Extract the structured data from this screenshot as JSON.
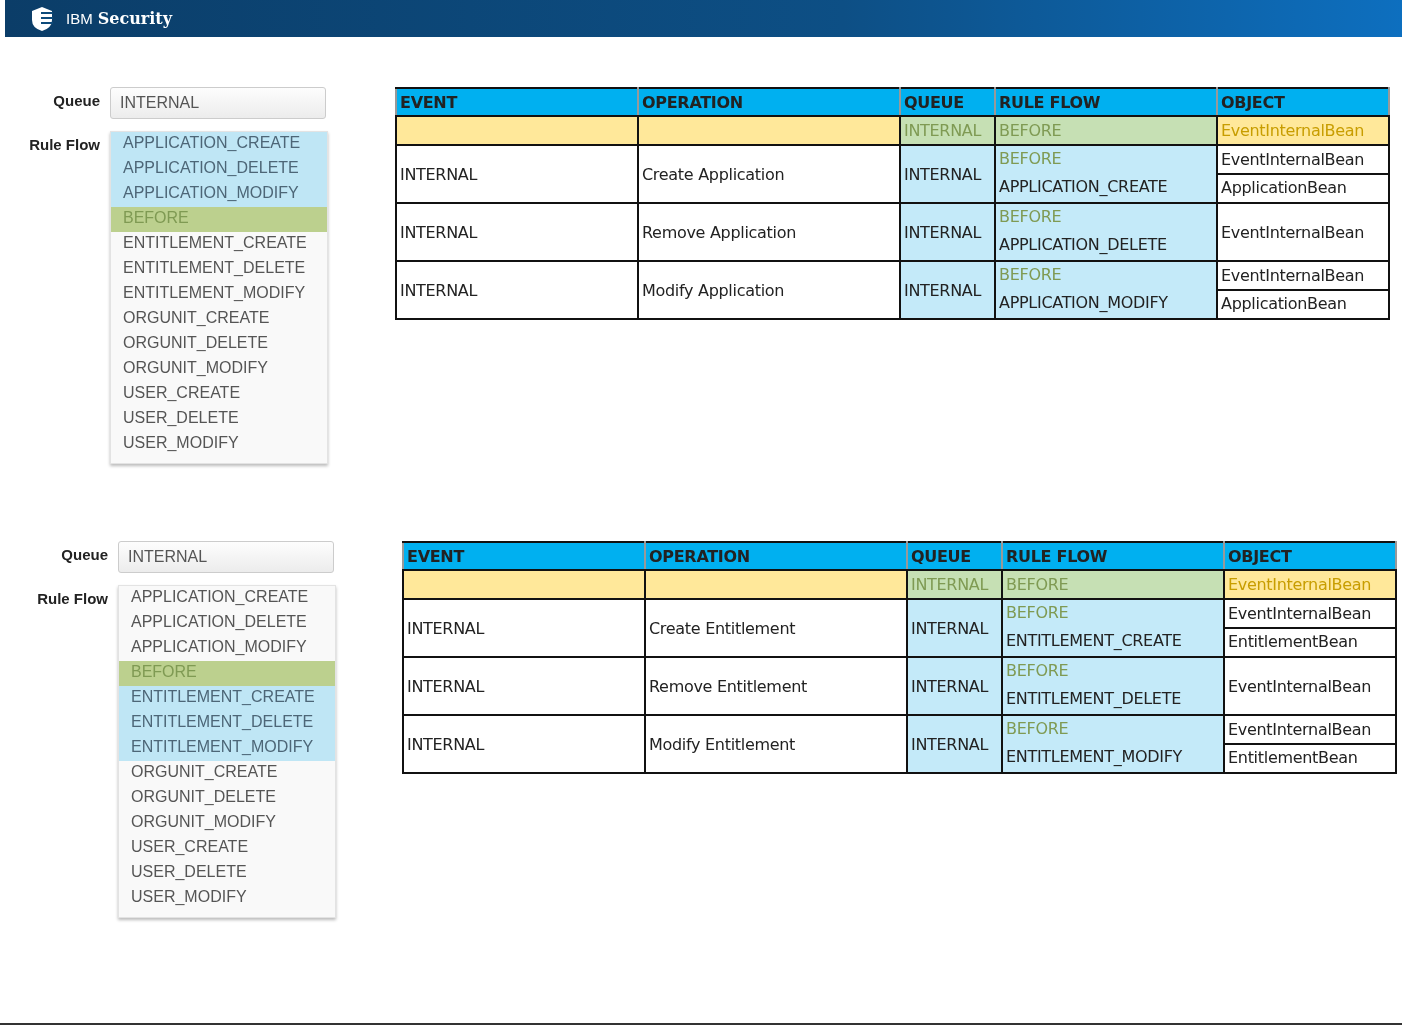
{
  "header": {
    "brand_light": "IBM",
    "brand_bold": "Security"
  },
  "sections": [
    {
      "form": {
        "queue_label": "Queue",
        "queue_value": "INTERNAL",
        "rule_flow_label": "Rule Flow",
        "rule_flows": [
          {
            "label": "APPLICATION_CREATE",
            "kind": "option",
            "selected": true
          },
          {
            "label": "APPLICATION_DELETE",
            "kind": "option",
            "selected": true
          },
          {
            "label": "APPLICATION_MODIFY",
            "kind": "option",
            "selected": true
          },
          {
            "label": "BEFORE",
            "kind": "fixed",
            "selected": false
          },
          {
            "label": "ENTITLEMENT_CREATE",
            "kind": "option",
            "selected": false
          },
          {
            "label": "ENTITLEMENT_DELETE",
            "kind": "option",
            "selected": false
          },
          {
            "label": "ENTITLEMENT_MODIFY",
            "kind": "option",
            "selected": false
          },
          {
            "label": "ORGUNIT_CREATE",
            "kind": "option",
            "selected": false
          },
          {
            "label": "ORGUNIT_DELETE",
            "kind": "option",
            "selected": false
          },
          {
            "label": "ORGUNIT_MODIFY",
            "kind": "option",
            "selected": false
          },
          {
            "label": "USER_CREATE",
            "kind": "option",
            "selected": false
          },
          {
            "label": "USER_DELETE",
            "kind": "option",
            "selected": false
          },
          {
            "label": "USER_MODIFY",
            "kind": "option",
            "selected": false
          }
        ]
      },
      "table": {
        "columns": [
          "EVENT",
          "OPERATION",
          "QUEUE",
          "RULE FLOW",
          "OBJECT"
        ],
        "default_row": {
          "queue": "INTERNAL",
          "rule_flow": "BEFORE",
          "object": "EventInternalBean"
        },
        "rows": [
          {
            "event": "INTERNAL",
            "operation": "Create Application",
            "queue": "INTERNAL",
            "rule_flow_before": "BEFORE",
            "rule_flow": "APPLICATION_CREATE",
            "objects": [
              "EventInternalBean",
              "ApplicationBean"
            ]
          },
          {
            "event": "INTERNAL",
            "operation": "Remove Application",
            "queue": "INTERNAL",
            "rule_flow_before": "BEFORE",
            "rule_flow": "APPLICATION_DELETE",
            "objects": [
              "EventInternalBean"
            ]
          },
          {
            "event": "INTERNAL",
            "operation": "Modify Application",
            "queue": "INTERNAL",
            "rule_flow_before": "BEFORE",
            "rule_flow": "APPLICATION_MODIFY",
            "objects": [
              "EventInternalBean",
              "ApplicationBean"
            ]
          }
        ]
      }
    },
    {
      "form": {
        "queue_label": "Queue",
        "queue_value": "INTERNAL",
        "rule_flow_label": "Rule Flow",
        "rule_flows": [
          {
            "label": "APPLICATION_CREATE",
            "kind": "option",
            "selected": false
          },
          {
            "label": "APPLICATION_DELETE",
            "kind": "option",
            "selected": false
          },
          {
            "label": "APPLICATION_MODIFY",
            "kind": "option",
            "selected": false
          },
          {
            "label": "BEFORE",
            "kind": "fixed",
            "selected": false
          },
          {
            "label": "ENTITLEMENT_CREATE",
            "kind": "option",
            "selected": true
          },
          {
            "label": "ENTITLEMENT_DELETE",
            "kind": "option",
            "selected": true
          },
          {
            "label": "ENTITLEMENT_MODIFY",
            "kind": "option",
            "selected": true
          },
          {
            "label": "ORGUNIT_CREATE",
            "kind": "option",
            "selected": false
          },
          {
            "label": "ORGUNIT_DELETE",
            "kind": "option",
            "selected": false
          },
          {
            "label": "ORGUNIT_MODIFY",
            "kind": "option",
            "selected": false
          },
          {
            "label": "USER_CREATE",
            "kind": "option",
            "selected": false
          },
          {
            "label": "USER_DELETE",
            "kind": "option",
            "selected": false
          },
          {
            "label": "USER_MODIFY",
            "kind": "option",
            "selected": false
          }
        ]
      },
      "table": {
        "columns": [
          "EVENT",
          "OPERATION",
          "QUEUE",
          "RULE FLOW",
          "OBJECT"
        ],
        "default_row": {
          "queue": "INTERNAL",
          "rule_flow": "BEFORE",
          "object": "EventInternalBean"
        },
        "rows": [
          {
            "event": "INTERNAL",
            "operation": "Create Entitlement",
            "queue": "INTERNAL",
            "rule_flow_before": "BEFORE",
            "rule_flow": "ENTITLEMENT_CREATE",
            "objects": [
              "EventInternalBean",
              "EntitlementBean"
            ]
          },
          {
            "event": "INTERNAL",
            "operation": "Remove Entitlement",
            "queue": "INTERNAL",
            "rule_flow_before": "BEFORE",
            "rule_flow": "ENTITLEMENT_DELETE",
            "objects": [
              "EventInternalBean"
            ]
          },
          {
            "event": "INTERNAL",
            "operation": "Modify Entitlement",
            "queue": "INTERNAL",
            "rule_flow_before": "BEFORE",
            "rule_flow": "ENTITLEMENT_MODIFY",
            "objects": [
              "EventInternalBean",
              "EntitlementBean"
            ]
          }
        ]
      }
    }
  ]
}
